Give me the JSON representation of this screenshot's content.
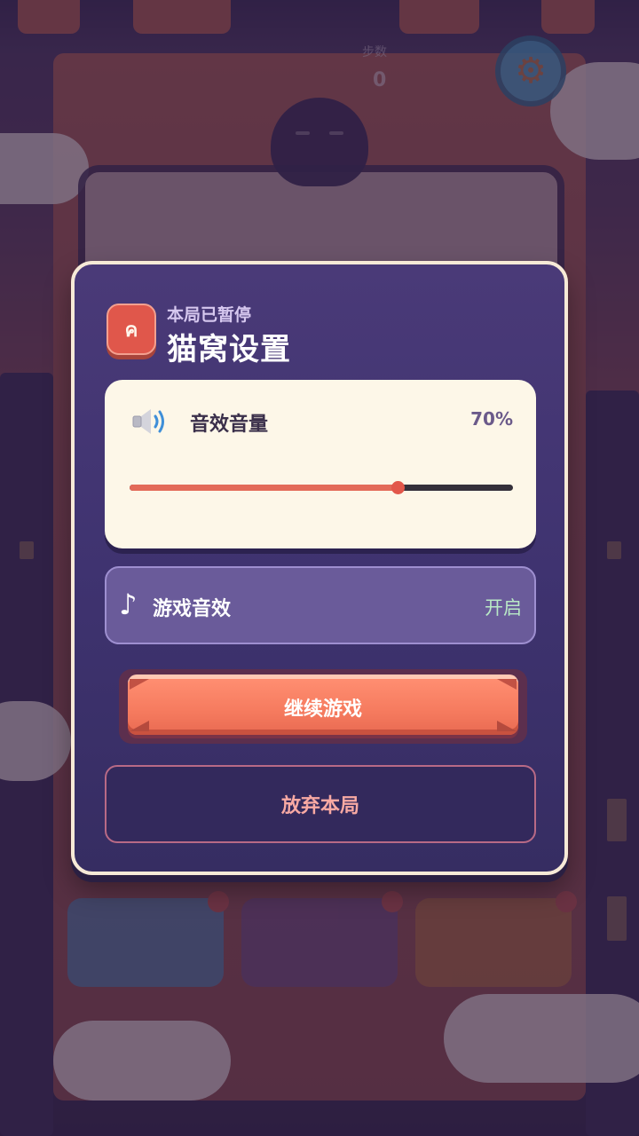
{
  "background": {
    "stats": [
      {
        "label": "",
        "value": ""
      },
      {
        "label": "步数",
        "value": "0"
      }
    ],
    "tools": [
      {
        "label": "",
        "badge": "",
        "color": "#3e96cf"
      },
      {
        "label": "",
        "badge": "",
        "color": "#6a4d95"
      },
      {
        "label": "",
        "badge": "",
        "color": "#c47a38"
      }
    ]
  },
  "dialog": {
    "subtitle": "本局已暂停",
    "title": "猫窝设置",
    "logo_glyph": "ค",
    "volume": {
      "icon": "speaker-icon",
      "label": "音效音量",
      "value_text": "70%",
      "level": 0.7
    },
    "sound": {
      "icon": "music-note-icon",
      "label": "游戏音效",
      "state": "开启"
    },
    "continue_label": "继续游戏",
    "abandon_label": "放弃本局"
  },
  "colors": {
    "dialog_border": "#f7ead7",
    "accent": "#f57a5e",
    "slider_fill": "#e36a58",
    "toggle_on": "#b9e9c6"
  }
}
